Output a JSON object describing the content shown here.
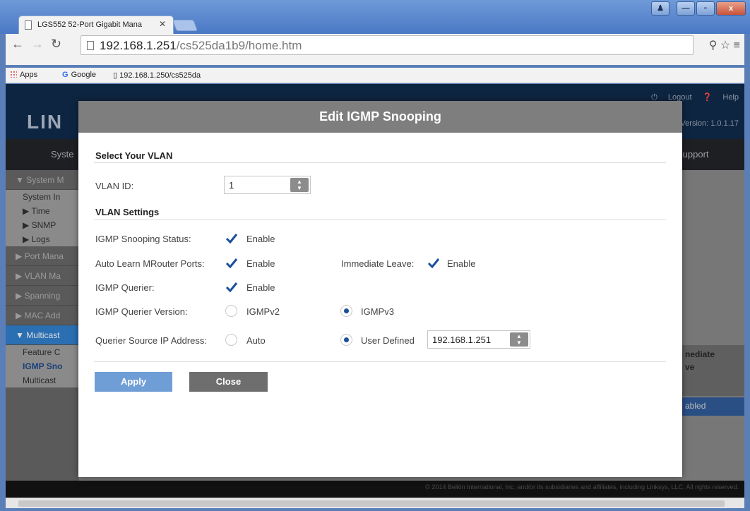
{
  "browser": {
    "tab_title": "LGS552 52-Port Gigabit Mana",
    "tab_close": "✕",
    "url_host": "192.168.1.251",
    "url_path": "/cs525da1b9/home.htm",
    "bookmarks": {
      "apps": "Apps",
      "google": "Google",
      "site": "192.168.1.250/cs525da"
    },
    "win_buttons": {
      "user": "♟",
      "min": "—",
      "max": "▫",
      "close": "x"
    }
  },
  "page": {
    "logo": "LIN",
    "header_links": {
      "logout": "Logout",
      "help": "Help"
    },
    "version": "Version: 1.0.1.17",
    "menu_left": "Syste",
    "menu_right": "Support",
    "sidebar": [
      {
        "label": "▼ System M",
        "kind": "group"
      },
      {
        "label": "System In",
        "kind": "sub"
      },
      {
        "label": "▶ Time",
        "kind": "sub"
      },
      {
        "label": "▶ SNMP",
        "kind": "sub"
      },
      {
        "label": "▶ Logs",
        "kind": "sub"
      },
      {
        "label": "▶ Port Mana",
        "kind": "group"
      },
      {
        "label": "▶ VLAN Ma",
        "kind": "group"
      },
      {
        "label": "▶ Spanning",
        "kind": "group"
      },
      {
        "label": "▶ MAC Add",
        "kind": "group"
      },
      {
        "label": "▼ Multicast",
        "kind": "active"
      },
      {
        "label": "Feature C",
        "kind": "sub"
      },
      {
        "label": "IGMP Sno",
        "kind": "cur"
      },
      {
        "label": "Multicast",
        "kind": "sub"
      }
    ],
    "table_header": "nediate\nve",
    "table_cell": "abled",
    "footer": "© 2014 Belkin International, Inc. and/or its subsidiaries and affiliates, including Linksys, LLC. All rights reserved."
  },
  "modal": {
    "title": "Edit IGMP Snooping",
    "section_vlan": "Select Your VLAN",
    "vlan_id_label": "VLAN ID:",
    "vlan_id_value": "1",
    "section_settings": "VLAN Settings",
    "snooping_status_label": "IGMP Snooping Status:",
    "snooping_status_opt": "Enable",
    "auto_learn_label": "Auto Learn MRouter Ports:",
    "auto_learn_opt": "Enable",
    "immediate_leave_label": "Immediate Leave:",
    "immediate_leave_opt": "Enable",
    "querier_label": "IGMP Querier:",
    "querier_opt": "Enable",
    "querier_version_label": "IGMP Querier Version:",
    "querier_version_v2": "IGMPv2",
    "querier_version_v3": "IGMPv3",
    "source_ip_label": "Querier Source IP Address:",
    "source_ip_auto": "Auto",
    "source_ip_user": "User Defined",
    "source_ip_value": "192.168.1.251",
    "apply_label": "Apply",
    "close_label": "Close"
  },
  "colors": {
    "accent": "#1b4f9b",
    "apply": "#6f9ed6",
    "close": "#6e6e6e",
    "title_bar": "#7e7e7e"
  }
}
